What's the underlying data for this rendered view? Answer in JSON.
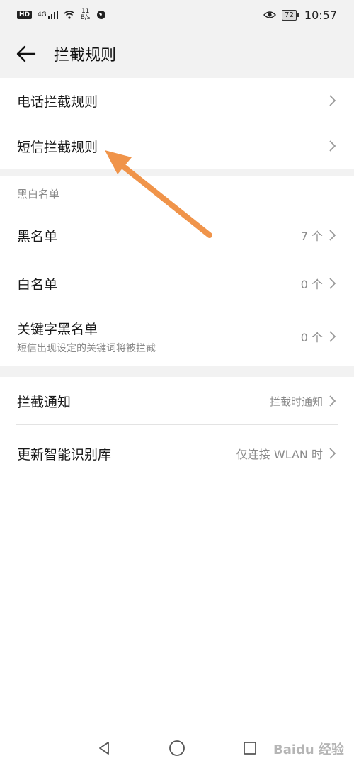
{
  "status": {
    "hd": "HD",
    "network": "4G",
    "speed_value": "11",
    "speed_unit": "B/s",
    "battery": "72",
    "time": "10:57"
  },
  "header": {
    "title": "拦截规则"
  },
  "rules": {
    "call_rules": "电话拦截规则",
    "sms_rules": "短信拦截规则"
  },
  "lists": {
    "section_title": "黑白名单",
    "blacklist": {
      "label": "黑名单",
      "value": "7 个"
    },
    "whitelist": {
      "label": "白名单",
      "value": "0 个"
    },
    "keyword": {
      "label": "关键字黑名单",
      "sub": "短信出现设定的关键词将被拦截",
      "value": "0 个"
    }
  },
  "settings": {
    "notify": {
      "label": "拦截通知",
      "value": "拦截时通知"
    },
    "update": {
      "label": "更新智能识别库",
      "value": "仅连接 WLAN 时"
    }
  },
  "annotation": {
    "arrow_color": "#f0944a"
  },
  "watermark": "Baidu 经验"
}
